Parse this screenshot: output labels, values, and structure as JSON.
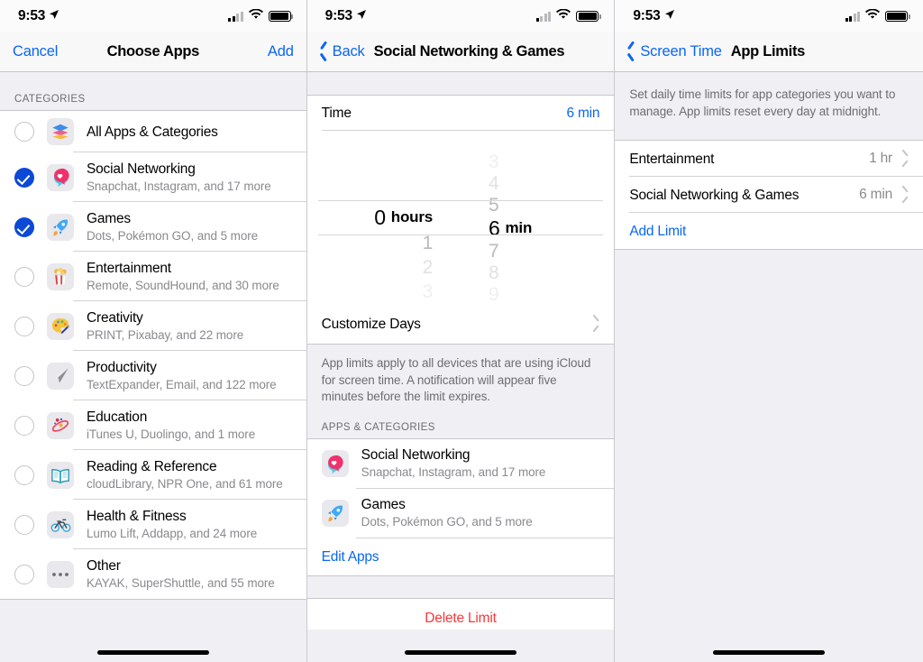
{
  "status_bar": {
    "time": "9:53",
    "location_icon": "location-arrow-icon",
    "wifi_icon": "wifi-icon",
    "battery_icon": "battery-icon",
    "signal_icon": "cellular-signal-icon"
  },
  "screen1": {
    "nav": {
      "cancel": "Cancel",
      "title": "Choose Apps",
      "add": "Add"
    },
    "section_header": "CATEGORIES",
    "rows": [
      {
        "title": "All Apps & Categories",
        "subtitle": "",
        "checked": false,
        "icon": "stack-layers-icon"
      },
      {
        "title": "Social Networking",
        "subtitle": "Snapchat, Instagram, and 17 more",
        "checked": true,
        "icon": "chat-bubble-heart-icon"
      },
      {
        "title": "Games",
        "subtitle": "Dots, Pokémon GO, and 5 more",
        "checked": true,
        "icon": "rocket-icon"
      },
      {
        "title": "Entertainment",
        "subtitle": "Remote, SoundHound, and 30 more",
        "checked": false,
        "icon": "popcorn-icon"
      },
      {
        "title": "Creativity",
        "subtitle": "PRINT, Pixabay, and 22 more",
        "checked": false,
        "icon": "paint-palette-icon"
      },
      {
        "title": "Productivity",
        "subtitle": "TextExpander, Email, and 122 more",
        "checked": false,
        "icon": "paper-plane-icon"
      },
      {
        "title": "Education",
        "subtitle": "iTunes U, Duolingo, and 1 more",
        "checked": false,
        "icon": "atom-icon"
      },
      {
        "title": "Reading & Reference",
        "subtitle": "cloudLibrary, NPR One, and 61 more",
        "checked": false,
        "icon": "open-book-icon"
      },
      {
        "title": "Health & Fitness",
        "subtitle": "Lumo Lift, Addapp, and 24 more",
        "checked": false,
        "icon": "bicycle-icon"
      },
      {
        "title": "Other",
        "subtitle": "KAYAK, SuperShuttle, and 55 more",
        "checked": false,
        "icon": "ellipsis-icon"
      }
    ]
  },
  "screen2": {
    "nav": {
      "back": "Back",
      "title": "Social Networking & Games"
    },
    "time_row": {
      "label": "Time",
      "value": "6 min"
    },
    "picker": {
      "hours": {
        "above": [
          "",
          ""
        ],
        "selected": "0",
        "unit": "hours",
        "below": [
          "1",
          "2",
          "3"
        ]
      },
      "minutes": {
        "above": [
          "3",
          "4",
          "5"
        ],
        "selected": "6",
        "unit": "min",
        "below": [
          "7",
          "8",
          "9"
        ]
      }
    },
    "customize_days": "Customize Days",
    "footnote": "App limits apply to all devices that are using iCloud for screen time. A notification will appear five minutes before the limit expires.",
    "apps_header": "APPS & CATEGORIES",
    "apps": [
      {
        "title": "Social Networking",
        "subtitle": "Snapchat, Instagram, and 17 more",
        "icon": "chat-bubble-heart-icon"
      },
      {
        "title": "Games",
        "subtitle": "Dots, Pokémon GO, and 5 more",
        "icon": "rocket-icon"
      }
    ],
    "edit_apps": "Edit Apps",
    "delete_limit": "Delete Limit"
  },
  "screen3": {
    "nav": {
      "back": "Screen Time",
      "title": "App Limits"
    },
    "description": "Set daily time limits for app categories you want to manage. App limits reset every day at midnight.",
    "limits": [
      {
        "title": "Entertainment",
        "value": "1 hr"
      },
      {
        "title": "Social Networking & Games",
        "value": "6 min"
      }
    ],
    "add_limit": "Add Limit"
  },
  "colors": {
    "accent_blue": "#0a66f5",
    "check_blue": "#0b49d6",
    "destructive_red": "#f5383a",
    "group_bg": "#efeff4",
    "secondary_text": "#8a8a8e"
  }
}
